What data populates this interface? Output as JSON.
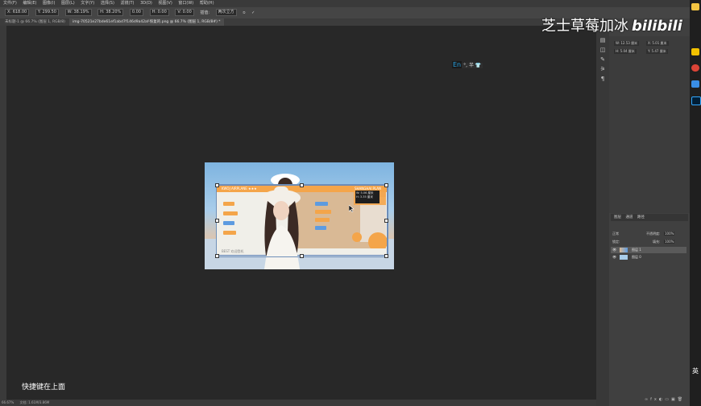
{
  "menubar": {
    "items": [
      "文件(F)",
      "编辑(E)",
      "图像(I)",
      "图层(L)",
      "文字(Y)",
      "选择(S)",
      "滤镜(T)",
      "3D(D)",
      "视图(V)",
      "窗口(W)",
      "帮助(H)"
    ]
  },
  "options": {
    "x_value": "X: 618.00",
    "y_value": "Y: 299.50",
    "w_value": "W: 38.19%",
    "h_value": "H: 38.20%",
    "angle_value": "0.00",
    "hskew": "H: 0.00",
    "vskew": "V: 0.00",
    "interp_label": "插值:",
    "interp_value": "两次立方"
  },
  "tabs": [
    {
      "label": "未标题-1 @ 66.7% (图层 1, RGB/8)",
      "active": false
    },
    {
      "label": "img-70521e27bde61ef1abd7f146d9a42af-恢复的.png @ 66.7% (图层 1, RGB/8#) *",
      "active": true
    }
  ],
  "status": {
    "zoom": "66.67%",
    "doc": "文档: 1.61M/3.86M"
  },
  "document": {
    "banner_title": "KWOJ AIRPLANE ★★★",
    "banner_right": "SHANGHAI PLAN",
    "banner_footer": "BEST 欢迎登机",
    "info_w": "W: 5.06 厘米",
    "info_h": "H: 3.35 厘米"
  },
  "ime": {
    "en": "En",
    "rest": "°, 半 👕"
  },
  "properties": {
    "w": "W: 12.53 厘米",
    "h": "H: 5.04 厘米",
    "x": "X: 5.01 厘米",
    "y": "Y: 5.47 厘米"
  },
  "layers_panel": {
    "tabs": [
      "图层",
      "通道",
      "路径"
    ],
    "mode": "正常",
    "opacity_label": "不透明度:",
    "opacity": "100%",
    "lock_label": "锁定:",
    "fill_label": "填充:",
    "fill": "100%",
    "layers": [
      {
        "name": "图层 1",
        "selected": true
      },
      {
        "name": "图层 0",
        "selected": false
      }
    ]
  },
  "watermark": {
    "name": "芝士草莓加冰",
    "logo": "bilibili"
  },
  "subtitle": "快捷键在上面",
  "taskbar": {
    "lang": "英"
  },
  "colors": {
    "accent_orange": "#f4a54a",
    "accent_blue": "#5d9be0",
    "ime_blue": "#29a3e2"
  }
}
